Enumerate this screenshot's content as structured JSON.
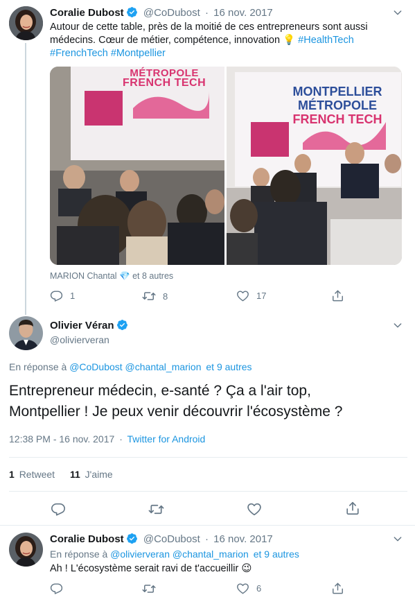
{
  "tweet1": {
    "name": "Coralie Dubost",
    "handle": "@CoDubost",
    "sep": "·",
    "date": "16 nov. 2017",
    "text_main": "Autour de cette table, près de la moitié de ces entrepreneurs sont aussi médecins. Cœur de métier, compétence, innovation ",
    "emoji": "💡",
    "hashtag1": "#HealthTech",
    "hashtag2": "#FrenchTech",
    "hashtag3": "#Montpellier",
    "photo1_banner_line1": "MÉTROPOLE",
    "photo1_banner_line2": "FRENCH TECH",
    "photo2_banner_line1": "MONTPELLIER",
    "photo2_banner_line2": "MÉTROPOLE",
    "photo2_banner_line3": "FRENCH TECH",
    "tagged_name": "MARION Chantal",
    "tagged_emoji": "💎",
    "tagged_rest": "et 8 autres",
    "replies": "1",
    "retweets": "8",
    "likes": "17"
  },
  "tweet2": {
    "name": "Olivier Véran",
    "handle": "@olivierveran",
    "reply_prefix": "En réponse à",
    "reply_mention1": "@CoDubost",
    "reply_mention2": "@chantal_marion",
    "reply_others": "et 9 autres",
    "text_line1": "Entrepreneur médecin, e-santé ? Ça a l'air top,",
    "text_line2": "Montpellier ! Je peux venir découvrir l'écosystème ?",
    "time": "12:38 PM - 16 nov. 2017",
    "sep": "·",
    "source": "Twitter for Android",
    "retweet_count": "1",
    "retweet_label": "Retweet",
    "like_count": "11",
    "like_label": "J'aime"
  },
  "tweet3": {
    "name": "Coralie Dubost",
    "handle": "@CoDubost",
    "sep": "·",
    "date": "16 nov. 2017",
    "reply_prefix": "En réponse à",
    "reply_mention1": "@olivierveran",
    "reply_mention2": "@chantal_marion",
    "reply_others": "et 9 autres",
    "text": "Ah ! L'écosystème serait ravi de t'accueillir ",
    "emoji": "😉",
    "likes": "6"
  },
  "icons": {
    "reply": "reply-icon",
    "retweet": "retweet-icon",
    "like": "heart-icon",
    "share": "share-icon",
    "verified": "verified-badge-icon",
    "more": "chevron-down-icon"
  },
  "colors": {
    "link": "#1b95e0",
    "verified": "#1da1f2",
    "muted": "#657786",
    "text": "#14171a"
  }
}
